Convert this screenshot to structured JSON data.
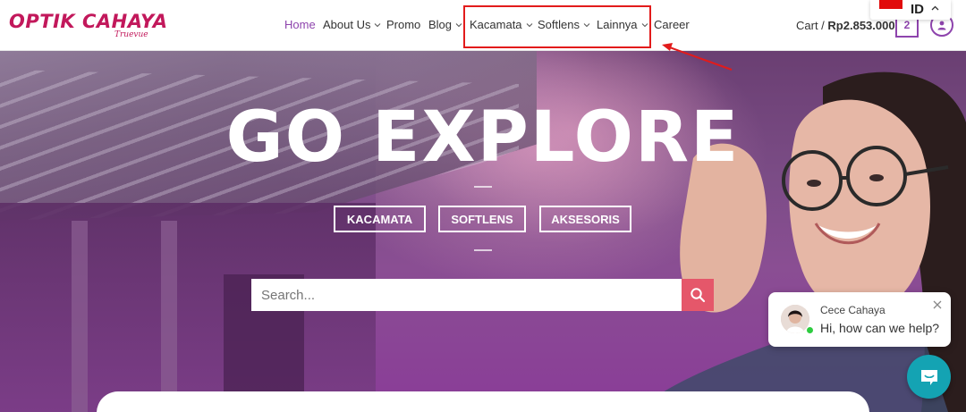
{
  "header": {
    "logo_text": "OPTIK CAHAYA",
    "logo_tagline": "Truevue",
    "nav": [
      {
        "label": "Home",
        "has_dropdown": false,
        "active": true
      },
      {
        "label": "About Us",
        "has_dropdown": true,
        "active": false
      },
      {
        "label": "Promo",
        "has_dropdown": false,
        "active": false
      },
      {
        "label": "Blog",
        "has_dropdown": true,
        "active": false
      },
      {
        "label": "Kacamata",
        "has_dropdown": true,
        "active": false
      },
      {
        "label": "Softlens",
        "has_dropdown": true,
        "active": false
      },
      {
        "label": "Lainnya",
        "has_dropdown": true,
        "active": false
      },
      {
        "label": "Career",
        "has_dropdown": false,
        "active": false
      }
    ],
    "cart_label": "Cart /",
    "cart_total": "Rp2.853.000",
    "cart_count": "2",
    "language": "ID"
  },
  "hero": {
    "title": "GO EXPLORE",
    "categories": [
      "KACAMATA",
      "SOFTLENS",
      "AKSESORIS"
    ],
    "search_placeholder": "Search..."
  },
  "chat": {
    "agent_name": "Cece Cahaya",
    "message": "Hi, how can we help?"
  },
  "colors": {
    "brand": "#c2185b",
    "accent": "#8e44ad",
    "search_button": "#e5576a",
    "chat_fab": "#14a3b3",
    "annotation": "#e21b1b"
  }
}
